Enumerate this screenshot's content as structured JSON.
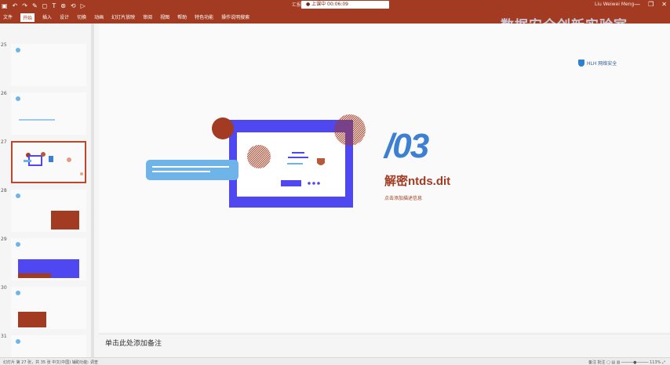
{
  "window": {
    "file_title": "汇报演示-T...",
    "search_placeholder": "● 上课中 00:06:09",
    "account": "Liu Weiwei Meng",
    "controls": [
      "—",
      "❐",
      "✕"
    ]
  },
  "ribbon": {
    "tabs": [
      "文件",
      "开始",
      "插入",
      "设计",
      "切换",
      "动画",
      "幻灯片放映",
      "审阅",
      "视图",
      "帮助",
      "特色功能",
      "操作说明搜索"
    ],
    "active_tab": "开始"
  },
  "watermark": "数据安全创新实验室",
  "thumbnails": [
    {
      "number": "25"
    },
    {
      "number": "26"
    },
    {
      "number": "27"
    },
    {
      "number": "28"
    },
    {
      "number": "29"
    },
    {
      "number": "30"
    },
    {
      "number": "31"
    }
  ],
  "slide": {
    "logo_text": "HLH 网络安全",
    "section_number": "/03",
    "section_title": "解密ntds.dit",
    "section_subtitle": "点击添加描述信息"
  },
  "notes": {
    "placeholder": "单击此处添加备注"
  },
  "status": {
    "left": "幻灯片 第 27 张，共 35 张   中文(中国)   辅助功能: 调查",
    "right": "备注  批注  ▢  ▤  ▥  ─────●───── 113%  ⤢"
  },
  "colors": {
    "brand": "#a23b21",
    "accent_blue": "#4f48f0",
    "light_blue": "#6fb4e8",
    "title_blue": "#3d7fd0"
  }
}
